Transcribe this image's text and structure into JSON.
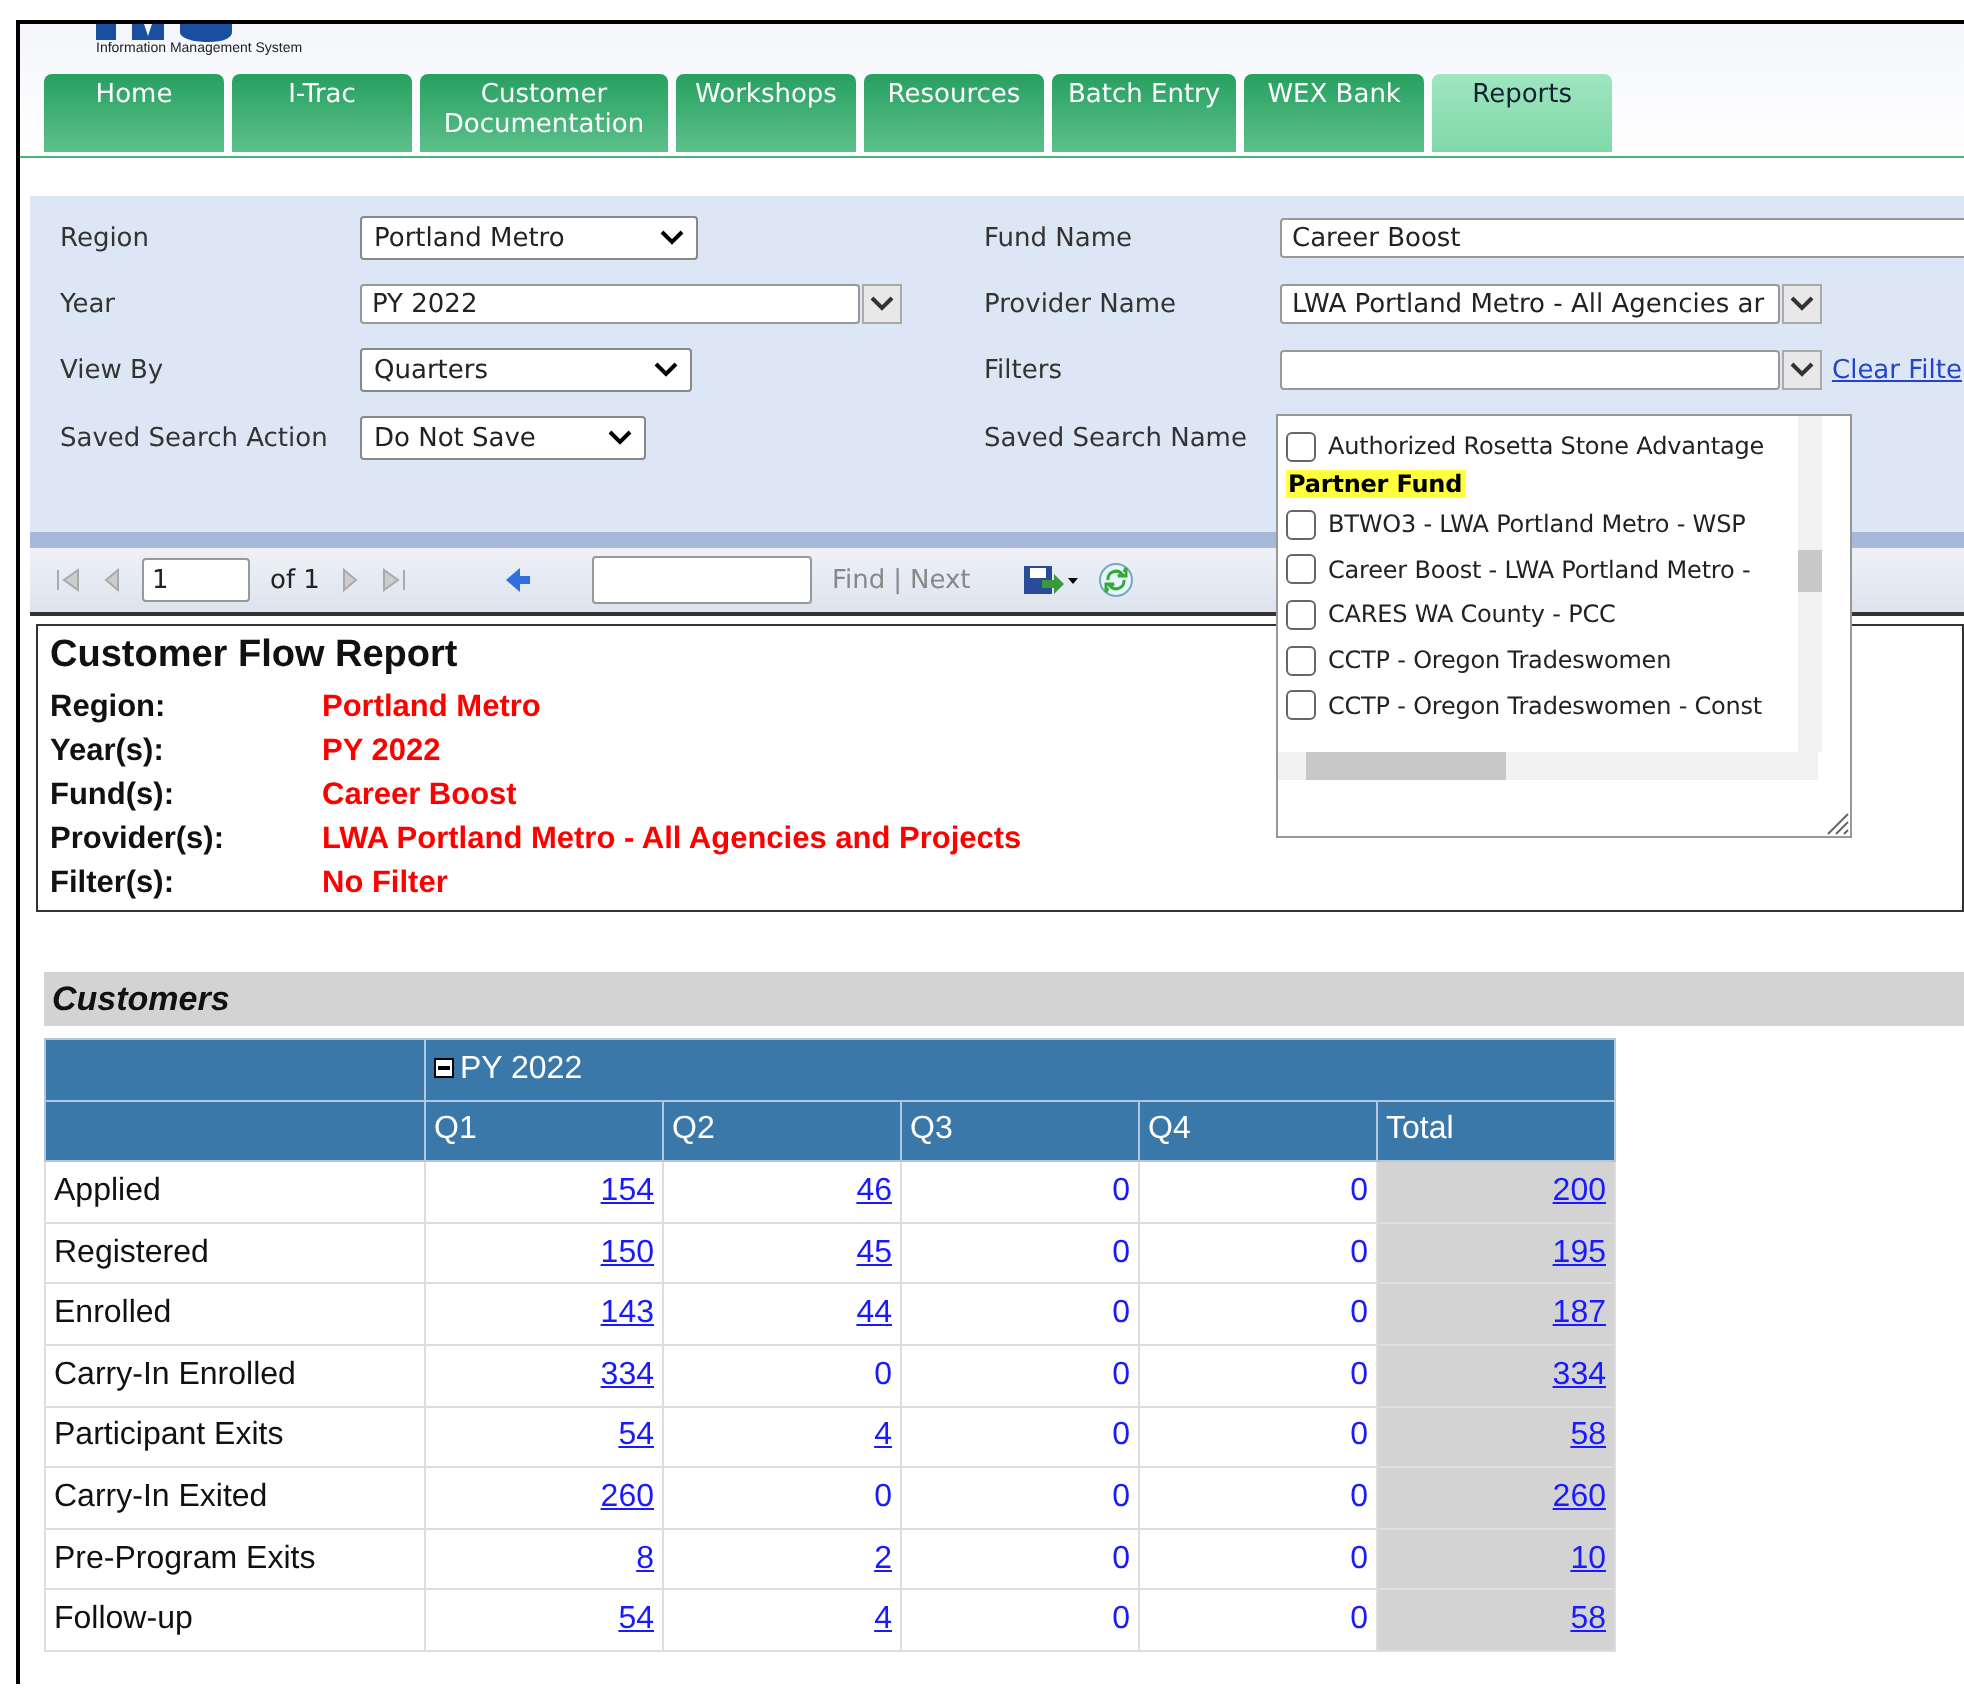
{
  "header": {
    "subtitle": "Information Management System"
  },
  "tabs": [
    {
      "label": "Home",
      "selected": false
    },
    {
      "label": "I-Trac",
      "selected": false
    },
    {
      "label": "Customer Documentation",
      "selected": false
    },
    {
      "label": "Workshops",
      "selected": false
    },
    {
      "label": "Resources",
      "selected": false
    },
    {
      "label": "Batch Entry",
      "selected": false
    },
    {
      "label": "WEX Bank",
      "selected": false
    },
    {
      "label": "Reports",
      "selected": true
    }
  ],
  "filters": {
    "region": {
      "label": "Region",
      "value": "Portland Metro"
    },
    "year": {
      "label": "Year",
      "value": "PY 2022"
    },
    "view_by": {
      "label": "View By",
      "value": "Quarters"
    },
    "saved_search_action": {
      "label": "Saved Search Action",
      "value": "Do Not Save"
    },
    "fund_name": {
      "label": "Fund Name",
      "value": "Career Boost"
    },
    "provider_name": {
      "label": "Provider Name",
      "value": "LWA Portland Metro - All Agencies ar"
    },
    "filters": {
      "label": "Filters",
      "clear_link": "Clear Filte"
    },
    "saved_search_name": {
      "label": "Saved Search Name"
    }
  },
  "filter_dropdown": {
    "items": [
      {
        "kind": "option",
        "label": "Authorized Rosetta Stone Advantage",
        "checked": false
      },
      {
        "kind": "group",
        "label": "Partner Fund"
      },
      {
        "kind": "option",
        "label": "BTWO3 - LWA Portland Metro - WSP",
        "checked": false
      },
      {
        "kind": "option",
        "label": "Career Boost - LWA Portland Metro -",
        "checked": false
      },
      {
        "kind": "option",
        "label": "CARES WA County - PCC",
        "checked": false
      },
      {
        "kind": "option",
        "label": "CCTP - Oregon Tradeswomen",
        "checked": false
      },
      {
        "kind": "option",
        "label": "CCTP - Oregon Tradeswomen - Const",
        "checked": false
      }
    ]
  },
  "toolbar": {
    "page": "1",
    "of": "of 1",
    "find": "Find",
    "separator": "|",
    "next": "Next"
  },
  "report": {
    "title": "Customer Flow Report",
    "fields": [
      {
        "label": "Region:",
        "value": "Portland Metro"
      },
      {
        "label": "Year(s):",
        "value": "PY 2022"
      },
      {
        "label": "Fund(s):",
        "value": "Career Boost"
      },
      {
        "label": "Provider(s):",
        "value": "LWA Portland Metro - All Agencies and Projects"
      },
      {
        "label": "Filter(s):",
        "value": "No Filter"
      }
    ]
  },
  "customers": {
    "title": "Customers",
    "group": "PY 2022",
    "expanded": true,
    "columns": [
      "Q1",
      "Q2",
      "Q3",
      "Q4",
      "Total"
    ],
    "rows": [
      {
        "label": "Applied",
        "cells": [
          {
            "value": "154",
            "link": true
          },
          {
            "value": "46",
            "link": true
          },
          {
            "value": "0",
            "link": false
          },
          {
            "value": "0",
            "link": false
          },
          {
            "value": "200",
            "link": true
          }
        ]
      },
      {
        "label": "Registered",
        "cells": [
          {
            "value": "150",
            "link": true
          },
          {
            "value": "45",
            "link": true
          },
          {
            "value": "0",
            "link": false
          },
          {
            "value": "0",
            "link": false
          },
          {
            "value": "195",
            "link": true
          }
        ]
      },
      {
        "label": "Enrolled",
        "cells": [
          {
            "value": "143",
            "link": true
          },
          {
            "value": "44",
            "link": true
          },
          {
            "value": "0",
            "link": false
          },
          {
            "value": "0",
            "link": false
          },
          {
            "value": "187",
            "link": true
          }
        ]
      },
      {
        "label": "Carry-In Enrolled",
        "cells": [
          {
            "value": "334",
            "link": true
          },
          {
            "value": "0",
            "link": false
          },
          {
            "value": "0",
            "link": false
          },
          {
            "value": "0",
            "link": false
          },
          {
            "value": "334",
            "link": true
          }
        ]
      },
      {
        "label": "Participant Exits",
        "cells": [
          {
            "value": "54",
            "link": true
          },
          {
            "value": "4",
            "link": true
          },
          {
            "value": "0",
            "link": false
          },
          {
            "value": "0",
            "link": false
          },
          {
            "value": "58",
            "link": true
          }
        ]
      },
      {
        "label": "Carry-In Exited",
        "cells": [
          {
            "value": "260",
            "link": true
          },
          {
            "value": "0",
            "link": false
          },
          {
            "value": "0",
            "link": false
          },
          {
            "value": "0",
            "link": false
          },
          {
            "value": "260",
            "link": true
          }
        ]
      },
      {
        "label": "Pre-Program Exits",
        "cells": [
          {
            "value": "8",
            "link": true
          },
          {
            "value": "2",
            "link": true
          },
          {
            "value": "0",
            "link": false
          },
          {
            "value": "0",
            "link": false
          },
          {
            "value": "10",
            "link": true
          }
        ]
      },
      {
        "label": "Follow-up",
        "cells": [
          {
            "value": "54",
            "link": true
          },
          {
            "value": "4",
            "link": true
          },
          {
            "value": "0",
            "link": false
          },
          {
            "value": "0",
            "link": false
          },
          {
            "value": "58",
            "link": true
          }
        ]
      }
    ]
  }
}
